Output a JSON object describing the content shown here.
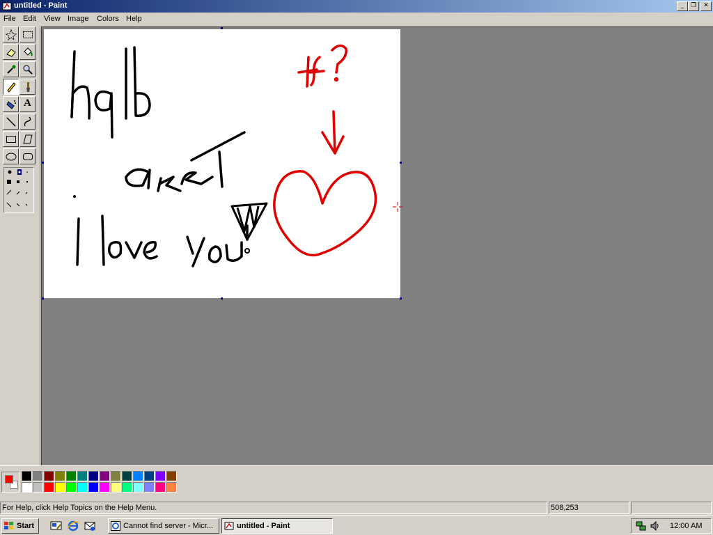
{
  "window": {
    "title": "untitled - Paint",
    "buttons": {
      "minimize": "_",
      "maximize": "❐",
      "close": "✕"
    }
  },
  "menu": [
    "File",
    "Edit",
    "View",
    "Image",
    "Colors",
    "Help"
  ],
  "tools": [
    {
      "name": "free-form-select-tool",
      "icon": "star-select-icon"
    },
    {
      "name": "select-tool",
      "icon": "rect-select-icon"
    },
    {
      "name": "eraser-tool",
      "icon": "eraser-icon"
    },
    {
      "name": "fill-tool",
      "icon": "paint-bucket-icon"
    },
    {
      "name": "pick-color-tool",
      "icon": "eyedropper-icon"
    },
    {
      "name": "magnifier-tool",
      "icon": "magnifier-icon"
    },
    {
      "name": "pencil-tool",
      "icon": "pencil-icon",
      "active": true
    },
    {
      "name": "brush-tool",
      "icon": "brush-icon"
    },
    {
      "name": "airbrush-tool",
      "icon": "airbrush-icon"
    },
    {
      "name": "text-tool",
      "icon": "text-icon"
    },
    {
      "name": "line-tool",
      "icon": "line-icon"
    },
    {
      "name": "curve-tool",
      "icon": "curve-icon"
    },
    {
      "name": "rectangle-tool",
      "icon": "rectangle-icon"
    },
    {
      "name": "polygon-tool",
      "icon": "polygon-icon"
    },
    {
      "name": "ellipse-tool",
      "icon": "ellipse-icon"
    },
    {
      "name": "rounded-rectangle-tool",
      "icon": "rounded-rectangle-icon"
    }
  ],
  "text_tool_glyph": "A",
  "canvas": {
    "drawing_text": [
      "hqlb",
      "akeT",
      "I love you!",
      "Tf?"
    ],
    "ink_colors": {
      "black": "#000000",
      "red": "#e00000"
    }
  },
  "colors": {
    "foreground": "#ff0000",
    "background": "#ffffff",
    "palette_top": [
      "#000000",
      "#808080",
      "#800000",
      "#808000",
      "#008000",
      "#008080",
      "#000080",
      "#800080",
      "#808040",
      "#004040",
      "#0080ff",
      "#004080",
      "#8000ff",
      "#804000"
    ],
    "palette_bottom": [
      "#ffffff",
      "#c0c0c0",
      "#ff0000",
      "#ffff00",
      "#00ff00",
      "#00ffff",
      "#0000ff",
      "#ff00ff",
      "#ffff80",
      "#00ff80",
      "#80ffff",
      "#8080ff",
      "#ff0080",
      "#ff8040"
    ]
  },
  "status": {
    "help": "For Help, click Help Topics on the Help Menu.",
    "coords": "508,253",
    "size": ""
  },
  "taskbar": {
    "start": "Start",
    "tasks": [
      {
        "label": "Cannot find server - Micr...",
        "icon": "ie-window-icon",
        "active": false
      },
      {
        "label": "untitled - Paint",
        "icon": "paint-icon",
        "active": true
      }
    ],
    "clock": "12:00 AM"
  }
}
